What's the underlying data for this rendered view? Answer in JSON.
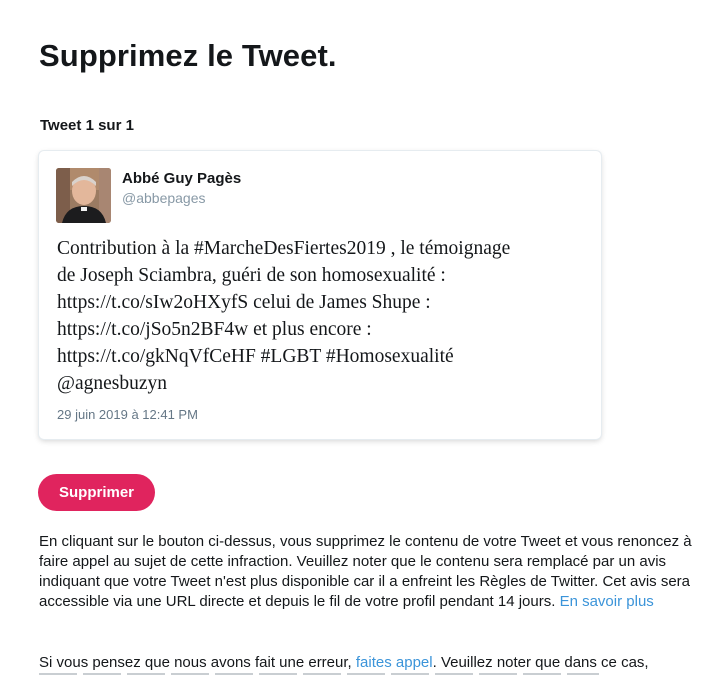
{
  "page": {
    "title": "Supprimez le Tweet."
  },
  "tweet_counter": "Tweet 1 sur 1",
  "tweet": {
    "author_name": "Abbé Guy Pagès",
    "author_handle": "@abbepages",
    "avatar_icon": "profile-photo-icon",
    "text_lines": [
      "Contribution à la #MarcheDesFiertes2019 , le témoignage",
      "de Joseph Sciambra, guéri de son homosexualité :",
      "https://t.co/sIw2oHXyfS celui de James Shupe :",
      "https://t.co/jSo5n2BF4w et plus encore :",
      "https://t.co/gkNqVfCeHF #LGBT #Homosexualité",
      "@agnesbuzyn"
    ],
    "date": "29 juin 2019 à 12:41 PM"
  },
  "actions": {
    "delete_label": "Supprimer"
  },
  "explanation": {
    "text": "En cliquant sur le bouton ci-dessus, vous supprimez le contenu de votre Tweet et vous renoncez à faire appel au sujet de cette infraction. Veuillez noter que le contenu sera remplacé par un avis indiquant que votre Tweet n'est plus disponible car il a enfreint les Règles de Twitter. Cet avis sera accessible via une URL directe et depuis le fil de votre profil pendant 14 jours.",
    "learn_more_link": "En savoir plus"
  },
  "appeal": {
    "text_before": "Si vous pensez que nous avons fait une erreur,",
    "link": "faites appel",
    "text_after": ". Veuillez noter que dans ce cas,"
  },
  "colors": {
    "accent": "#e0245e",
    "link": "#3b94d9",
    "muted": "#657786",
    "text": "#14171a"
  }
}
